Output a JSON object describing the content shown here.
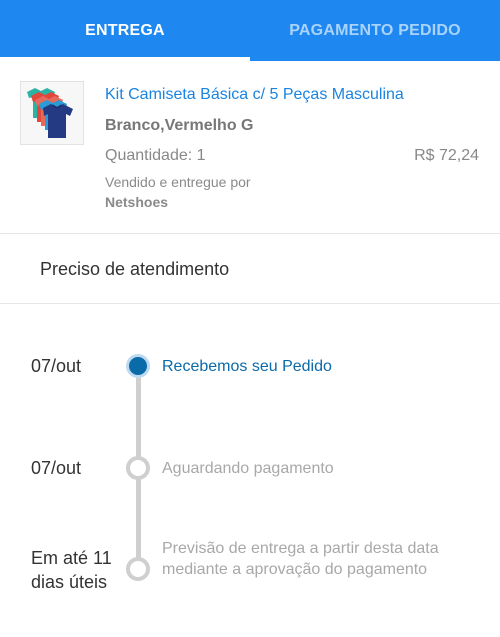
{
  "tabs": [
    {
      "label": "ENTREGA",
      "active": true
    },
    {
      "label": "PAGAMENTO PEDIDO",
      "active": false
    }
  ],
  "product": {
    "name": "Kit Camiseta Básica c/ 5 Peças Masculina",
    "variant": "Branco,Vermelho G",
    "quantity": "Quantidade: 1",
    "price": "R$ 72,24",
    "sold_by": "Vendido e entregue por",
    "seller": "Netshoes"
  },
  "help": {
    "label": "Preciso de atendimento"
  },
  "timeline": [
    {
      "date": "07/out",
      "status": "Recebemos seu Pedido",
      "state": "done"
    },
    {
      "date": "07/out",
      "status": "Aguardando pagamento",
      "state": "pending"
    },
    {
      "date": "Em até 11 dias úteis",
      "date_line1": "Em até 11",
      "date_line2": "dias úteis",
      "status": "Previsão de entrega a partir desta data mediante a aprovação do pagamento",
      "state": "pending"
    }
  ],
  "colors": {
    "accent": "#1e88f0",
    "link": "#1a84e0",
    "active_step": "#0b6aa8",
    "pending_step": "#cfcfcf"
  }
}
